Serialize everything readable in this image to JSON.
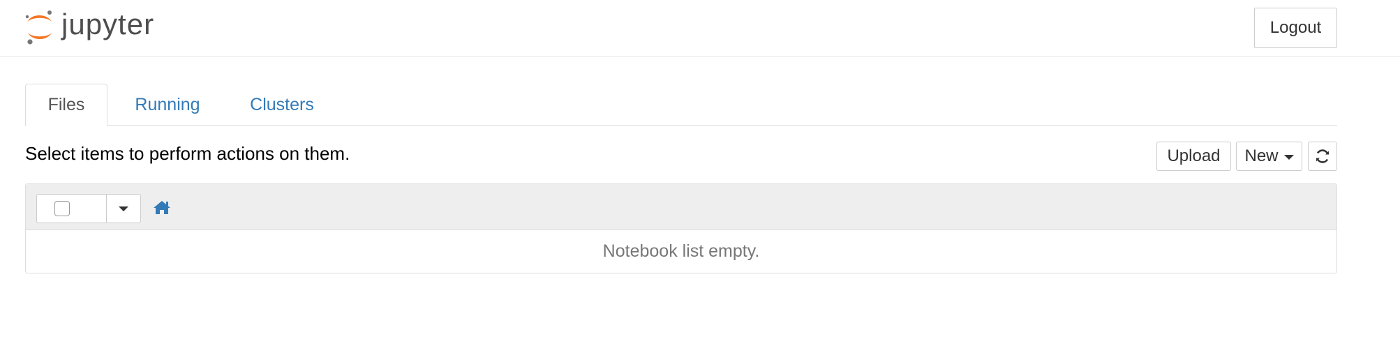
{
  "header": {
    "logo_text": "jupyter",
    "logout_label": "Logout"
  },
  "tabs": [
    {
      "label": "Files",
      "active": true
    },
    {
      "label": "Running",
      "active": false
    },
    {
      "label": "Clusters",
      "active": false
    }
  ],
  "toolbar": {
    "hint": "Select items to perform actions on them.",
    "upload_label": "Upload",
    "new_label": "New",
    "refresh_icon": "refresh-icon"
  },
  "notebook_list": {
    "empty_message": "Notebook list empty.",
    "home_icon": "home-icon",
    "select_all_checked": false
  },
  "colors": {
    "link": "#337ab7",
    "logo_orange": "#f37726",
    "logo_text": "#4e4e4e",
    "panel_head_bg": "#eeeeee",
    "empty_text": "#777777"
  }
}
